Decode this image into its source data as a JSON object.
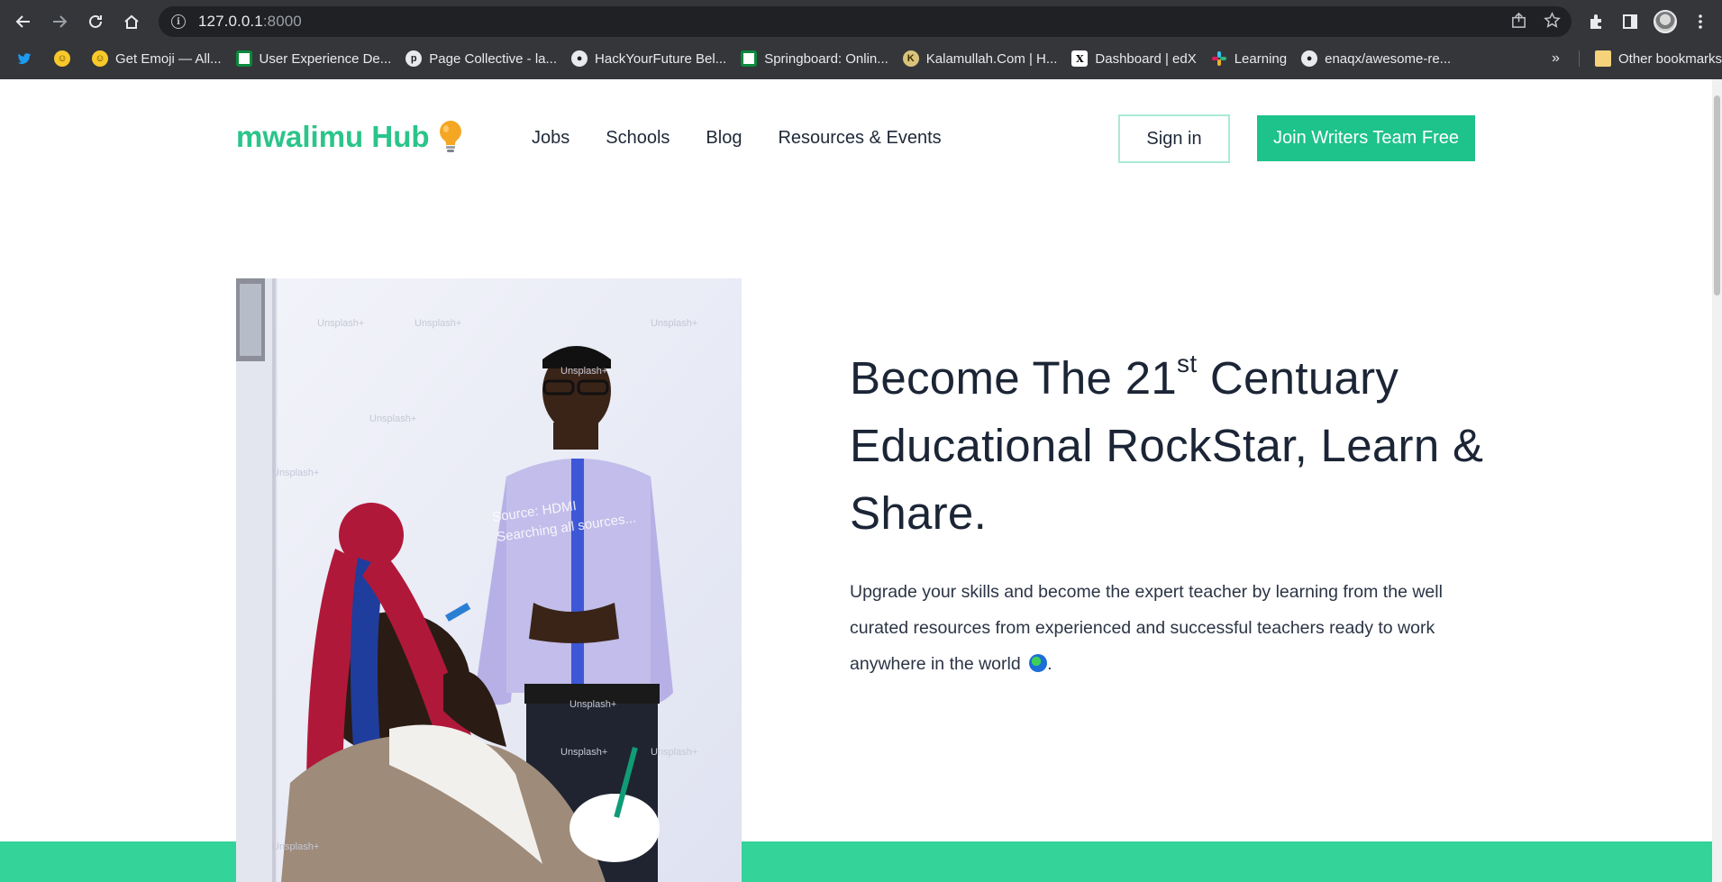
{
  "browser": {
    "url_host": "127.0.0.1",
    "url_port": ":8000",
    "bookmarks": [
      {
        "label": "",
        "icon": "twitter-icon"
      },
      {
        "label": "",
        "icon": "emoji-icon"
      },
      {
        "label": "Get Emoji — All...",
        "icon": "emoji-icon"
      },
      {
        "label": "User Experience De...",
        "icon": "green-square-icon"
      },
      {
        "label": "Page Collective - la...",
        "icon": "page-collective-icon"
      },
      {
        "label": "HackYourFuture Bel...",
        "icon": "github-icon"
      },
      {
        "label": "Springboard: Onlin...",
        "icon": "green-square-icon"
      },
      {
        "label": "Kalamullah.Com | H...",
        "icon": "kalamullah-icon"
      },
      {
        "label": "Dashboard | edX",
        "icon": "edx-icon"
      },
      {
        "label": "Learning",
        "icon": "slack-icon"
      },
      {
        "label": "enaqx/awesome-re...",
        "icon": "github-icon"
      }
    ],
    "more_label": "»",
    "other_bookmarks": "Other bookmarks"
  },
  "site": {
    "logo": "mwalimu Hub",
    "nav": [
      "Jobs",
      "Schools",
      "Blog",
      "Resources & Events"
    ],
    "signin": "Sign in",
    "join": "Join Writers Team Free"
  },
  "hero": {
    "title_a": "Become The 21",
    "title_sup": "st",
    "title_b": " Centuary Educational RockStar, Learn & Share.",
    "description": "Upgrade your skills and become the expert teacher by learning from the well curated resources from experienced and successful teachers ready to work anywhere in the world",
    "description_end": ".",
    "image_alt": "Teacher standing in front of a whiteboard with a student in the foreground",
    "watermark": "Unsplash+"
  },
  "colors": {
    "brand": "#2bc48a",
    "button": "#1ec28b",
    "band": "#34d399",
    "chrome": "#35363a"
  }
}
